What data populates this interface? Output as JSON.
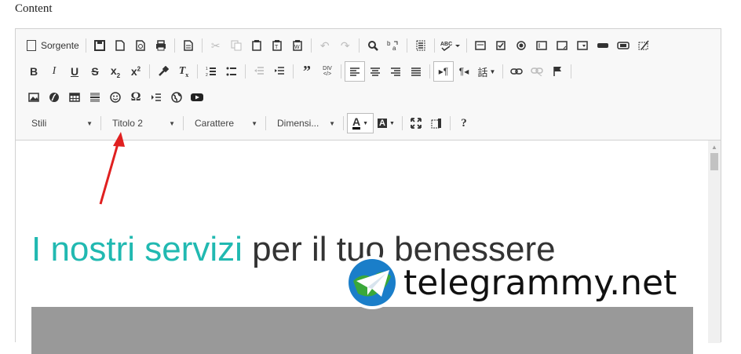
{
  "field_label": "Content",
  "toolbar": {
    "source_label": "Sorgente",
    "styles_combo": "Stili",
    "format_combo": "Titolo 2",
    "font_combo": "Carattere",
    "size_combo": "Dimensi...",
    "help_label": "?"
  },
  "editor": {
    "heading_accent": "I nostri servizi",
    "heading_rest": " per il tuo benessere"
  },
  "watermark": {
    "text": "telegrammy.net"
  },
  "colors": {
    "accent": "#21b9b1",
    "annotation_arrow": "#e02020"
  }
}
